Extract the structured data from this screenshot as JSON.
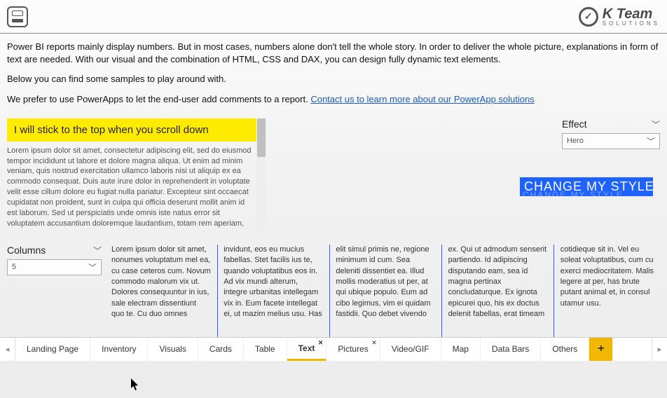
{
  "brand": {
    "name": "K Team",
    "sub": "SOLUTIONS"
  },
  "intro": {
    "p1": "Power BI reports mainly display numbers. But in most cases, numbers alone don't tell the whole story. In order to deliver the whole picture, explanations in form of text are needed. With our visual and the combination of HTML, CSS and DAX, you can design fully dynamic text elements.",
    "p2": "Below you can find some samples to play around with.",
    "p3_pre": "We prefer to use PowerApps to let the end-user add comments to a report. ",
    "p3_link": "Contact us to learn more about our PowerApp solutions"
  },
  "sticky": {
    "banner": "I will stick to the top when you scroll down"
  },
  "lorem_scroll": "Lorem ipsum dolor sit amet, consectetur adipiscing elit, sed do eiusmod tempor incididunt ut labore et dolore magna aliqua. Ut enim ad minim veniam, quis nostrud exercitation ullamco laboris nisi ut aliquip ex ea commodo consequat. Duis aute irure dolor in reprehenderit in voluptate velit esse cillum dolore eu fugiat nulla pariatur. Excepteur sint occaecat cupidatat non proident, sunt in culpa qui officia deserunt mollit anim id est laborum. Sed ut perspiciatis unde omnis iste natus error sit voluptatem accusantium doloremque laudantium, totam rem aperiam, eaque ipsa quae ab illo inventore veritatis et quasi architecto beatae vitae dicta sunt explicabo. Nemo enim ipsam voluptatem quia voluptas sit",
  "effect": {
    "title": "Effect",
    "selected": "Hero",
    "hero_text": "CHANGE MY STYLE"
  },
  "columns": {
    "title": "Columns",
    "selected": "5",
    "text": "Lorem ipsum dolor sit amet, nonumes voluptatum mel ea, cu case ceteros cum. Novum commodo malorum vix ut. Dolores consequuntur in ius, sale electram dissentiunt quo te. Cu duo omnes invidunt, eos eu mucius fabellas. Stet facilis ius te, quando voluptatibus eos in. Ad vix mundi alterum, integre urbanitas intellegam vix in. Eum facete intellegat ei, ut mazim melius usu. Has elit simul primis ne, regione minimum id cum. Sea deleniti dissentiet ea. Illud mollis moderatius ut per, at qui ubique populo. Eum ad cibo legimus, vim ei quidam fastidii. Quo debet vivendo ex. Qui ut admodum senserit partiendo. Id adipiscing disputando eam, sea id magna pertinax concludaturque. Ex ignota epicurei quo, his ex doctus delenit fabellas, erat timeam cotidieque sit in. Vel eu soleat voluptatibus, cum cu exerci mediocritatem. Malis legere at per, has brute putant animal et, in consul utamur usu."
  },
  "tabs": {
    "items": [
      {
        "label": "Landing Page",
        "active": false,
        "closable": false
      },
      {
        "label": "Inventory",
        "active": false,
        "closable": false
      },
      {
        "label": "Visuals",
        "active": false,
        "closable": false
      },
      {
        "label": "Cards",
        "active": false,
        "closable": false
      },
      {
        "label": "Table",
        "active": false,
        "closable": false
      },
      {
        "label": "Text",
        "active": true,
        "closable": true
      },
      {
        "label": "Pictures",
        "active": false,
        "closable": true
      },
      {
        "label": "Video/GIF",
        "active": false,
        "closable": false
      },
      {
        "label": "Map",
        "active": false,
        "closable": false
      },
      {
        "label": "Data Bars",
        "active": false,
        "closable": false
      },
      {
        "label": "Others",
        "active": false,
        "closable": false
      }
    ],
    "add": "+"
  }
}
